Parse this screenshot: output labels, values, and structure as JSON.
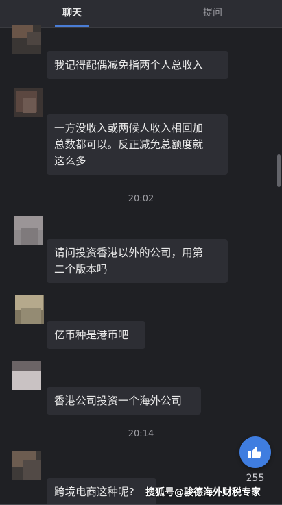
{
  "tabs": {
    "chat_label": "聊天",
    "ask_label": "提问"
  },
  "messages": [
    {
      "text": "我记得配偶减免指两个人总收入"
    },
    {
      "text": "一方没收入或两候人收入相回加\n总数都可以。反正减免总额度就\n这么多"
    },
    {
      "text": "请问投资香港以外的公司，用第\n二个版本吗"
    },
    {
      "text": "亿币种是港币吧"
    },
    {
      "text": "香港公司投资一个海外公司"
    },
    {
      "text": "跨境电商这种呢?"
    }
  ],
  "timestamps": [
    "20:02",
    "20:14"
  ],
  "like": {
    "icon": "thumbs-up-icon",
    "count": "255",
    "color": "#3f7de0"
  },
  "watermark": "搜狐号@骏德海外财税专家"
}
